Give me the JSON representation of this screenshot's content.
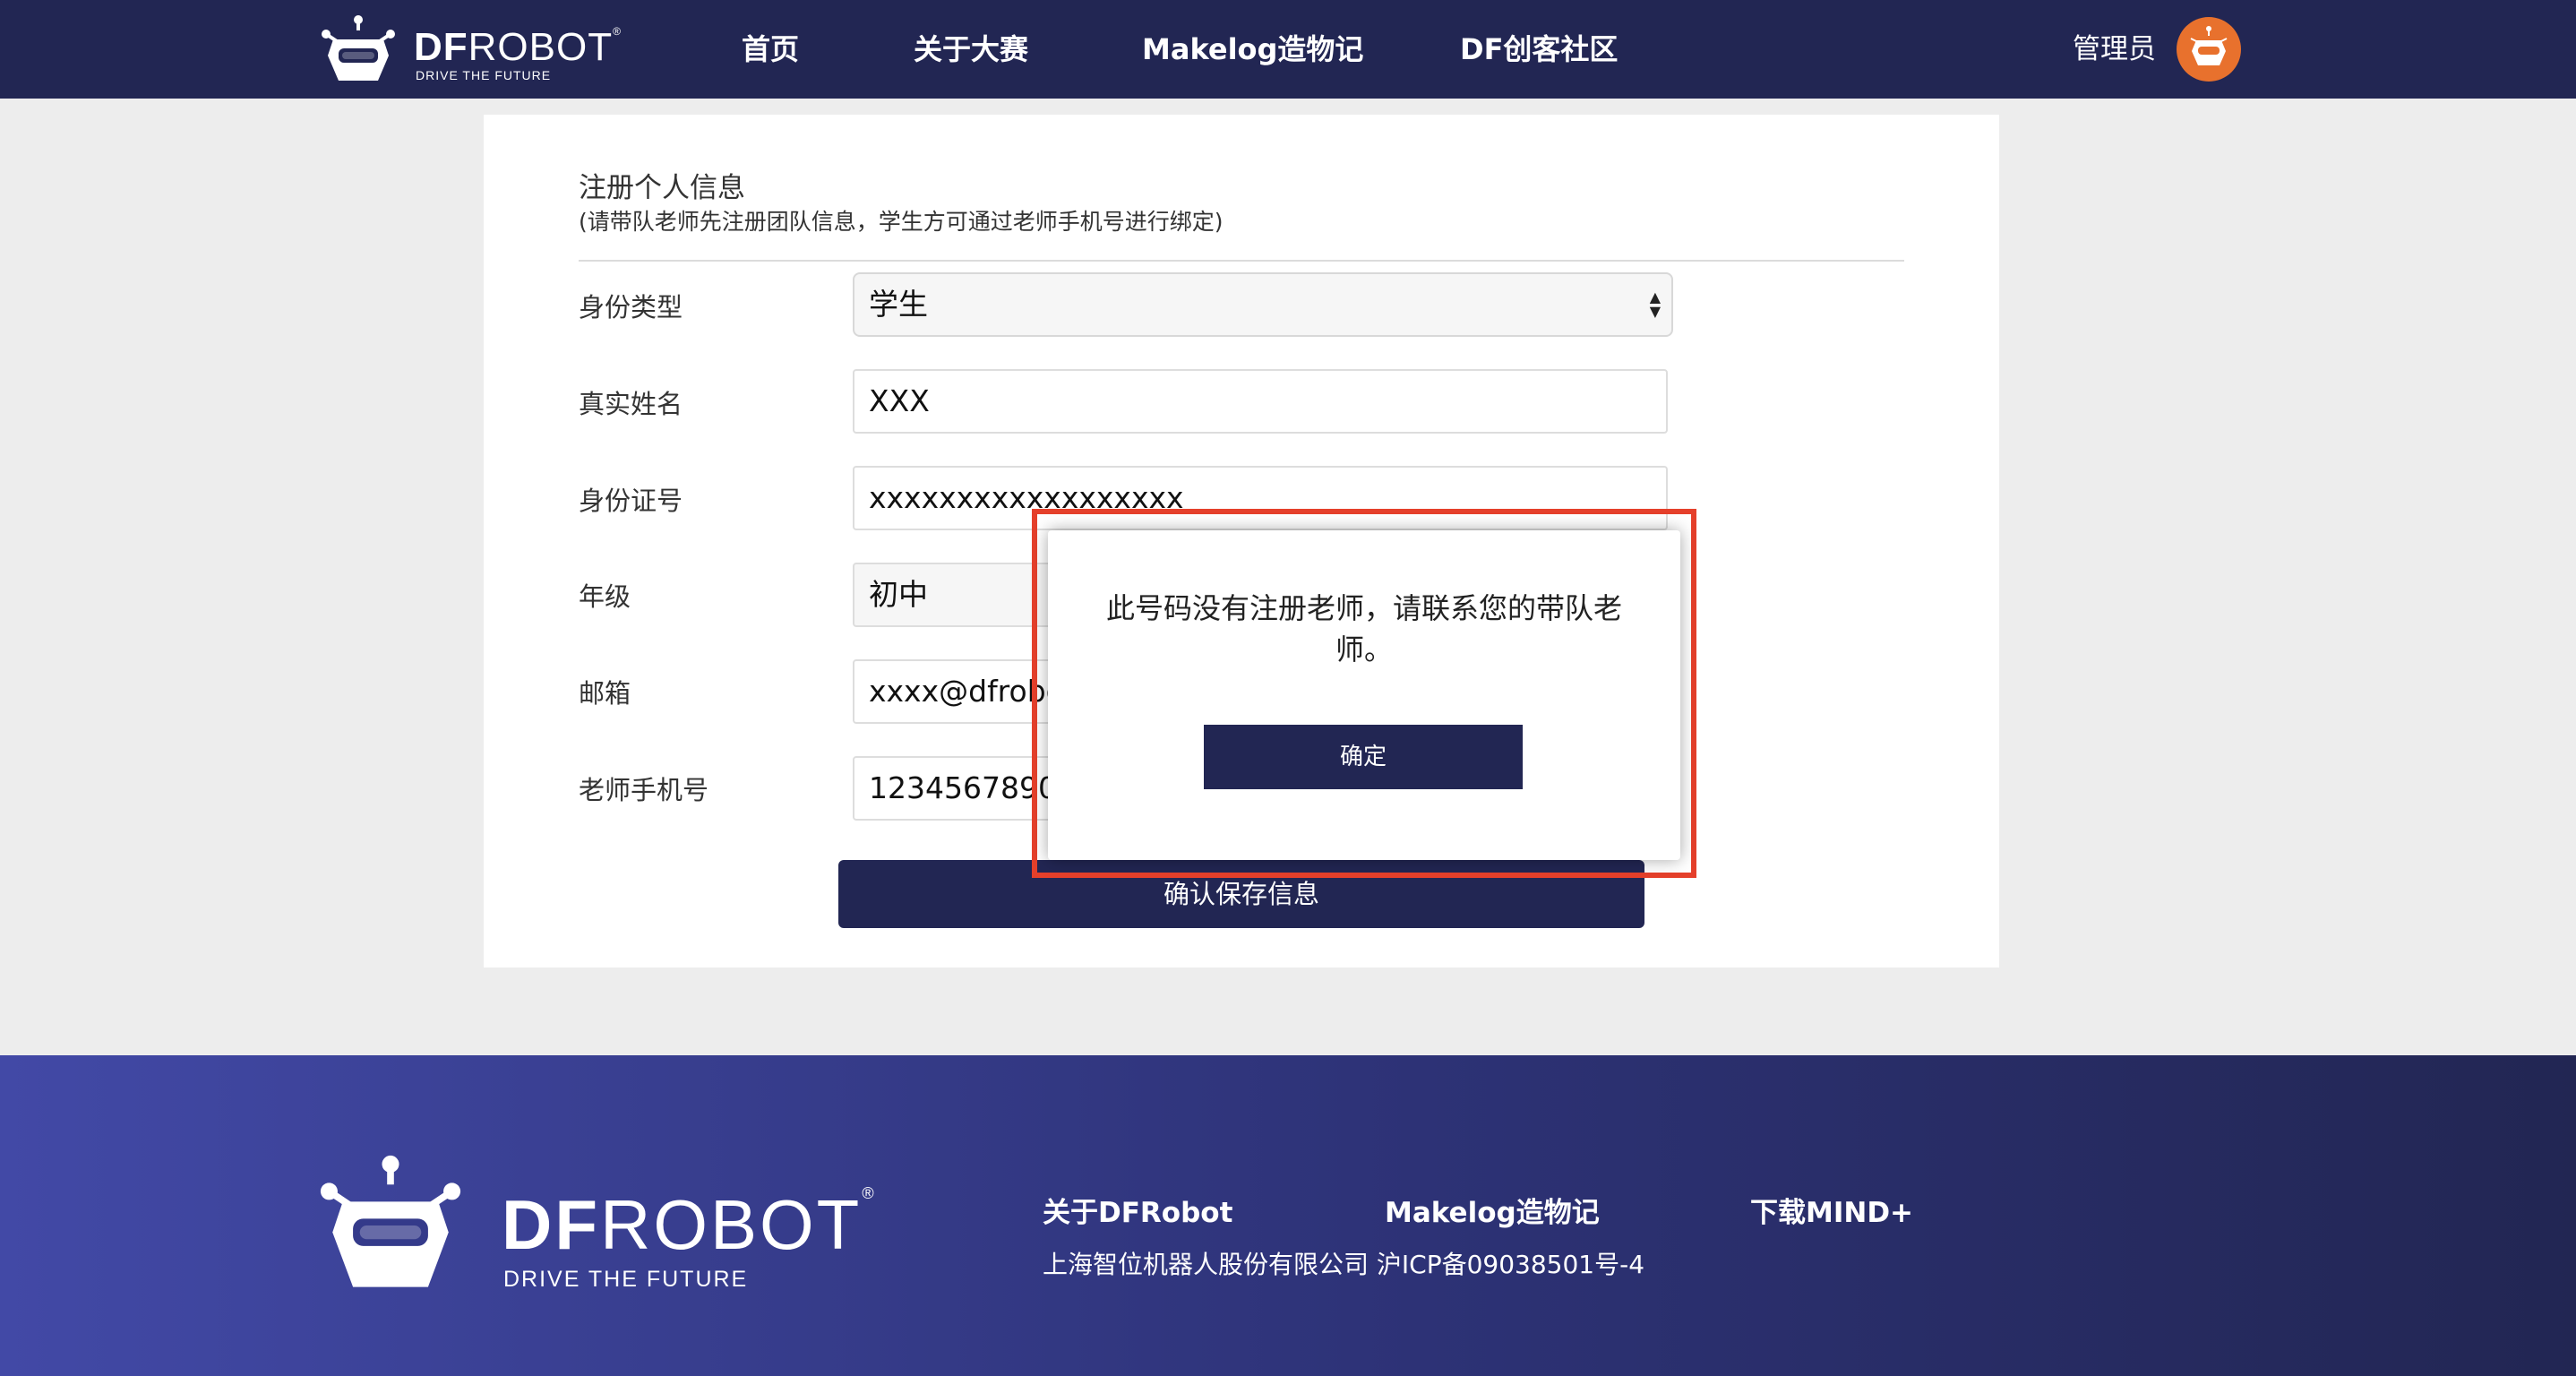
{
  "header": {
    "brand": {
      "part_bold": "DF",
      "part_thin": "ROBOT",
      "reg": "®",
      "tagline": "DRIVE THE FUTURE"
    },
    "nav": [
      "首页",
      "关于大赛",
      "Makelog造物记",
      "DF创客社区"
    ],
    "user": "管理员"
  },
  "form": {
    "title": "注册个人信息",
    "subtitle": "(请带队老师先注册团队信息，学生方可通过老师手机号进行绑定)",
    "fields": [
      {
        "label": "身份类型",
        "value": "学生"
      },
      {
        "label": "真实姓名",
        "value": "XXX"
      },
      {
        "label": "身份证号",
        "value": "xxxxxxxxxxxxxxxxxx"
      },
      {
        "label": "年级",
        "value": "初中"
      },
      {
        "label": "邮箱",
        "value": "xxxx@dfrobot.com"
      },
      {
        "label": "老师手机号",
        "value": "12345678900"
      }
    ],
    "save_label": "确认保存信息"
  },
  "modal": {
    "message": "此号码没有注册老师，请联系您的带队老师。",
    "ok_label": "确定"
  },
  "footer": {
    "brand": {
      "part_bold": "DF",
      "part_thin": "ROBOT",
      "reg": "®",
      "tagline": "DRIVE THE FUTURE"
    },
    "links": [
      "关于DFRobot",
      "Makelog造物记",
      "下载MIND+"
    ],
    "company": "上海智位机器人股份有限公司 沪ICP备09038501号-4"
  },
  "colors": {
    "navy": "#222653",
    "accent_orange": "#e8712d",
    "highlight_red": "#e5402b"
  }
}
